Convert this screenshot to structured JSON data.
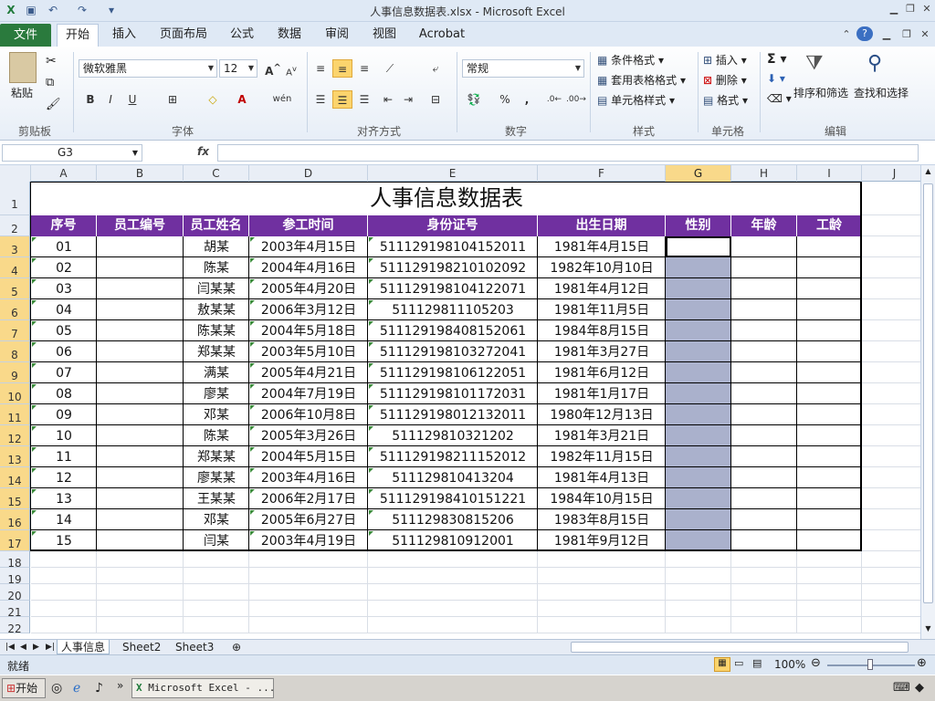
{
  "window": {
    "title": "人事信息数据表.xlsx - Microsoft Excel"
  },
  "ribbon_tabs": [
    "文件",
    "开始",
    "插入",
    "页面布局",
    "公式",
    "数据",
    "审阅",
    "视图",
    "Acrobat"
  ],
  "ribbon": {
    "paste_label": "粘贴",
    "font_name": "微软雅黑",
    "font_size": "12",
    "number_format": "常规",
    "styles_items": [
      "条件格式",
      "套用表格格式",
      "单元格样式"
    ],
    "cells_items": [
      "插入",
      "删除",
      "格式"
    ],
    "sort_label": "排序和筛选",
    "find_label": "查找和选择",
    "groups": [
      "剪贴板",
      "字体",
      "对齐方式",
      "数字",
      "样式",
      "单元格",
      "编辑"
    ],
    "bold": "B",
    "italic": "I",
    "underline": "U",
    "percent": "%",
    "comma": ",",
    "sum": "Σ"
  },
  "formula_bar": {
    "name_box": "G3",
    "fx": "fx",
    "value": ""
  },
  "columns": [
    "A",
    "B",
    "C",
    "D",
    "E",
    "F",
    "G",
    "H",
    "I",
    "J"
  ],
  "sheet": {
    "title": "人事信息数据表",
    "headers": [
      "序号",
      "员工编号",
      "员工姓名",
      "参工时间",
      "身份证号",
      "出生日期",
      "性别",
      "年龄",
      "工龄"
    ],
    "rows": [
      [
        "01",
        "",
        "胡某",
        "2003年4月15日",
        "511129198104152011",
        "1981年4月15日"
      ],
      [
        "02",
        "",
        "陈某",
        "2004年4月16日",
        "511129198210102092",
        "1982年10月10日"
      ],
      [
        "03",
        "",
        "闫某某",
        "2005年4月20日",
        "511129198104122071",
        "1981年4月12日"
      ],
      [
        "04",
        "",
        "敖某某",
        "2006年3月12日",
        "511129811105203",
        "1981年11月5日"
      ],
      [
        "05",
        "",
        "陈某某",
        "2004年5月18日",
        "511129198408152061",
        "1984年8月15日"
      ],
      [
        "06",
        "",
        "郑某某",
        "2003年5月10日",
        "511129198103272041",
        "1981年3月27日"
      ],
      [
        "07",
        "",
        "满某",
        "2005年4月21日",
        "511129198106122051",
        "1981年6月12日"
      ],
      [
        "08",
        "",
        "廖某",
        "2004年7月19日",
        "511129198101172031",
        "1981年1月17日"
      ],
      [
        "09",
        "",
        "邓某",
        "2006年10月8日",
        "511129198012132011",
        "1980年12月13日"
      ],
      [
        "10",
        "",
        "陈某",
        "2005年3月26日",
        "511129810321202",
        "1981年3月21日"
      ],
      [
        "11",
        "",
        "郑某某",
        "2004年5月15日",
        "511129198211152012",
        "1982年11月15日"
      ],
      [
        "12",
        "",
        "廖某某",
        "2003年4月16日",
        "511129810413204",
        "1981年4月13日"
      ],
      [
        "13",
        "",
        "王某某",
        "2006年2月17日",
        "511129198410151221",
        "1984年10月15日"
      ],
      [
        "14",
        "",
        "邓某",
        "2005年6月27日",
        "511129830815206",
        "1983年8月15日"
      ],
      [
        "15",
        "",
        "闫某",
        "2003年4月19日",
        "511129810912001",
        "1981年9月12日"
      ]
    ],
    "row_numbers": [
      "1",
      "2",
      "3",
      "4",
      "5",
      "6",
      "7",
      "8",
      "9",
      "10",
      "11",
      "12",
      "13",
      "14",
      "15",
      "16",
      "17",
      "18",
      "19",
      "20",
      "21",
      "22"
    ]
  },
  "sheet_tabs": [
    "人事信息",
    "Sheet2",
    "Sheet3"
  ],
  "status": {
    "ready": "就绪",
    "zoom": "100%"
  },
  "taskbar": {
    "start": "开始",
    "app": "Microsoft Excel - ..."
  },
  "colors": {
    "header_bg": "#7030a0",
    "selection": "#aab1cc",
    "file_tab": "#2a7a3d"
  }
}
